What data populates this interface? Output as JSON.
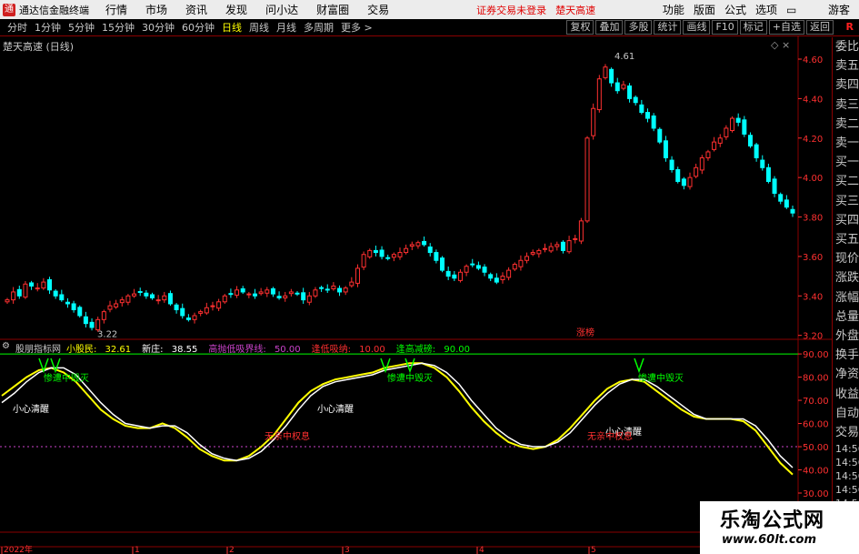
{
  "menu": {
    "app_name": "通达信金融终端",
    "items": [
      "行情",
      "市场",
      "资讯",
      "发现",
      "问小达",
      "财富圈",
      "交易"
    ],
    "warning": "证券交易未登录",
    "stock_name": "楚天高速",
    "right_items": [
      "功能",
      "版面",
      "公式",
      "选项"
    ],
    "guest": "游客"
  },
  "periods": {
    "items": [
      "分时",
      "1分钟",
      "5分钟",
      "15分钟",
      "30分钟",
      "60分钟",
      "日线",
      "周线",
      "月线",
      "多周期",
      "更多 >"
    ],
    "active": "日线"
  },
  "toolbar_right": [
    "复权",
    "叠加",
    "多股",
    "统计",
    "画线",
    "F10",
    "标记",
    "+自选",
    "返回"
  ],
  "toolbar_logo": "R",
  "price_panel": {
    "title": "楚天高速 (日线)",
    "axis_ticks": [
      "4.60",
      "4.40",
      "4.20",
      "4.00",
      "3.80",
      "3.60",
      "3.40",
      "3.20"
    ],
    "high_label": "4.61",
    "low_label": "3.22",
    "event_label": "涨榜",
    "controls": "◇ ×"
  },
  "indicator": {
    "name": "股朋指标网",
    "fields": [
      {
        "label": "小股民:",
        "value": "32.61",
        "color": "#ffff00"
      },
      {
        "label": "新庄:",
        "value": "38.55",
        "color": "#ffffff"
      },
      {
        "label": "高抛低吸界线:",
        "value": "50.00",
        "color": "#cc44cc"
      },
      {
        "label": "逢低吸纳:",
        "value": "10.00",
        "color": "#ff3030"
      },
      {
        "label": "逢高减磅:",
        "value": "90.00",
        "color": "#00ff00"
      }
    ],
    "axis_ticks": [
      "90.00",
      "80.00",
      "70.00",
      "60.00",
      "50.00",
      "40.00",
      "30.00"
    ],
    "annotations": {
      "careful": "小心清醒",
      "crash": "惨遭中毁灭",
      "noplay": "无亲中权息"
    }
  },
  "date_axis": [
    "2022年",
    "1",
    "2",
    "3",
    "4",
    "5"
  ],
  "right_panel": [
    "委比",
    "卖五",
    "卖四",
    "卖三",
    "卖二",
    "卖一",
    "买一",
    "买二",
    "买三",
    "买四",
    "买五",
    "现价",
    "涨跌",
    "涨幅",
    "总量",
    "外盘",
    "换手",
    "净资",
    "收益",
    "自动",
    "交易",
    "14:56",
    "14:56",
    "14:56",
    "14:56",
    "14:56",
    "14:56"
  ],
  "brand": {
    "line1": "乐淘公式网",
    "line2": "www.60lt.com"
  },
  "colors": {
    "up": "#ff3030",
    "down": "#00ffff",
    "grid_red": "#8a0000",
    "line_yellow": "#ffff00",
    "line_green": "#00ff00"
  },
  "chart_data": [
    {
      "type": "candlestick",
      "title": "楚天高速 (日线)",
      "ylim": [
        3.18,
        4.66
      ],
      "note": "daily candles approximated from screenshot",
      "x": "trading day index",
      "closes": [
        3.38,
        3.42,
        3.4,
        3.46,
        3.45,
        3.44,
        3.47,
        3.43,
        3.4,
        3.38,
        3.36,
        3.33,
        3.3,
        3.26,
        3.24,
        3.28,
        3.32,
        3.35,
        3.36,
        3.38,
        3.4,
        3.41,
        3.42,
        3.4,
        3.39,
        3.38,
        3.4,
        3.36,
        3.33,
        3.3,
        3.28,
        3.3,
        3.32,
        3.34,
        3.35,
        3.37,
        3.4,
        3.41,
        3.43,
        3.42,
        3.41,
        3.4,
        3.42,
        3.43,
        3.41,
        3.39,
        3.4,
        3.42,
        3.41,
        3.38,
        3.4,
        3.43,
        3.44,
        3.43,
        3.45,
        3.42,
        3.44,
        3.47,
        3.54,
        3.61,
        3.63,
        3.62,
        3.6,
        3.59,
        3.61,
        3.62,
        3.64,
        3.66,
        3.67,
        3.66,
        3.62,
        3.58,
        3.53,
        3.5,
        3.49,
        3.52,
        3.55,
        3.56,
        3.54,
        3.52,
        3.49,
        3.47,
        3.5,
        3.53,
        3.56,
        3.58,
        3.6,
        3.62,
        3.63,
        3.64,
        3.65,
        3.66,
        3.63,
        3.68,
        3.69,
        3.78,
        4.2,
        4.35,
        4.5,
        4.56,
        4.48,
        4.44,
        4.47,
        4.4,
        4.38,
        4.33,
        4.3,
        4.25,
        4.18,
        4.1,
        4.04,
        3.98,
        3.96,
        4.0,
        4.05,
        4.1,
        4.13,
        4.18,
        4.2,
        4.25,
        4.3,
        4.28,
        4.22,
        4.16,
        4.1,
        4.05,
        3.98,
        3.92,
        3.88,
        3.85,
        3.82
      ]
    },
    {
      "type": "line",
      "ylim": [
        30,
        92
      ],
      "series": [
        {
          "name": "小股民",
          "values": [
            72,
            76,
            80,
            83,
            84,
            82,
            78,
            72,
            66,
            62,
            59,
            58,
            58,
            60,
            58,
            54,
            49,
            46,
            44,
            44,
            46,
            50,
            55,
            62,
            69,
            74,
            77,
            79,
            80,
            81,
            82,
            84,
            85,
            86,
            86,
            84,
            80,
            74,
            67,
            61,
            56,
            52,
            50,
            49,
            50,
            53,
            58,
            64,
            70,
            75,
            78,
            79,
            78,
            74,
            70,
            66,
            63,
            62,
            62,
            62,
            61,
            57,
            50,
            43,
            38
          ]
        },
        {
          "name": "新庄",
          "values": [
            69,
            73,
            78,
            82,
            84,
            84,
            81,
            75,
            69,
            64,
            60,
            59,
            58,
            59,
            59,
            56,
            51,
            47,
            45,
            44,
            45,
            48,
            53,
            59,
            66,
            72,
            76,
            78,
            79,
            80,
            81,
            83,
            84,
            85,
            86,
            85,
            82,
            77,
            70,
            64,
            58,
            54,
            51,
            50,
            50,
            52,
            56,
            62,
            68,
            73,
            77,
            79,
            79,
            76,
            72,
            68,
            64,
            62,
            62,
            62,
            62,
            59,
            53,
            46,
            41
          ]
        }
      ],
      "reference_lines": {
        "高抛低吸界线": 50,
        "逢低吸纳": 10,
        "逢高减磅": 90
      }
    }
  ]
}
